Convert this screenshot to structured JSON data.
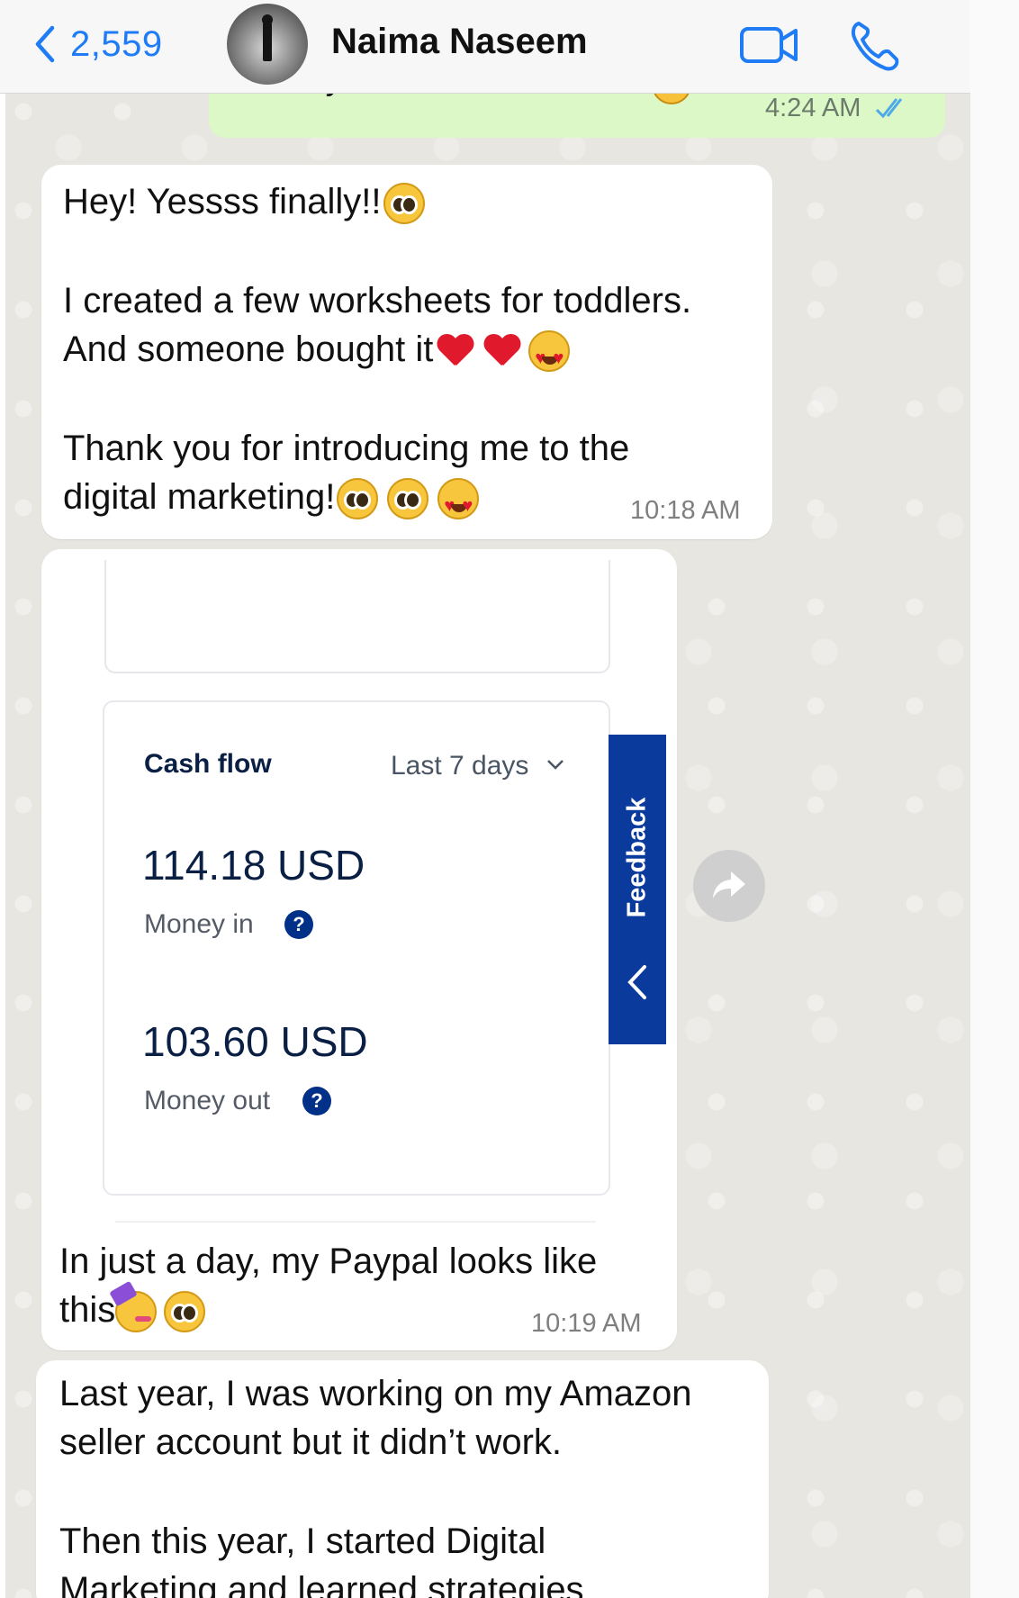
{
  "header": {
    "back_count": "2,559",
    "contact_name": "Naima Naseem",
    "icons": {
      "back": "chevron-left-icon",
      "video": "video-camera-icon",
      "call": "phone-icon"
    },
    "accent_color": "#1f7cf4"
  },
  "outgoing": {
    "text": "Made your first sale????",
    "time": "4:24 AM",
    "status_icon": "double-check-icon"
  },
  "messages": [
    {
      "line1": "Hey! Yessss finally!!",
      "line2": "I created a few worksheets for toddlers.",
      "line3": "And someone bought it",
      "line4": "Thank you for introducing me to the",
      "line5": "digital marketing!",
      "time": "10:18 AM"
    },
    {
      "card": {
        "title": "Cash flow",
        "range": "Last 7 days",
        "money_in_amount": "114.18 USD",
        "money_in_label": "Money in",
        "money_out_amount": "103.60 USD",
        "money_out_label": "Money out",
        "help_glyph": "?",
        "feedback_label": "Feedback"
      },
      "line1": "In just a day, my Paypal looks like",
      "line2": "this",
      "time": "10:19 AM"
    },
    {
      "line1": "Last year, I was working on my Amazon",
      "line2": "seller account but it didn’t work.",
      "line3": "Then this year, I started Digital",
      "line4": "Marketing and learned strategies"
    }
  ],
  "colors": {
    "outgoing_bubble": "#dcf8c6",
    "incoming_bubble": "#ffffff",
    "wallpaper": "#e8e6e1",
    "paypal_navy": "#0a3a9c"
  }
}
